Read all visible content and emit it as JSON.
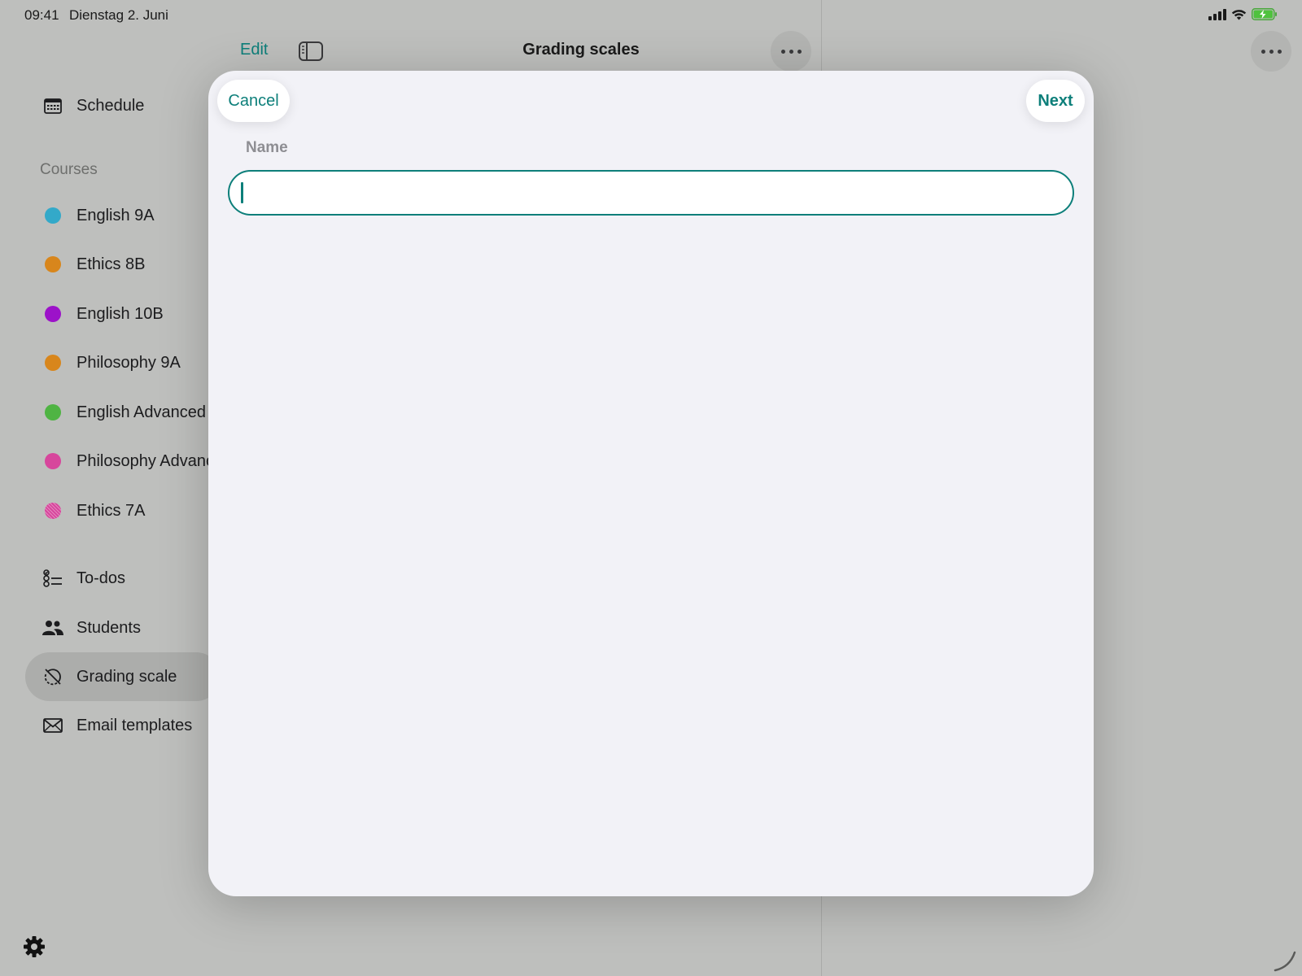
{
  "status_bar": {
    "time": "09:41",
    "date": "Dienstag 2. Juni",
    "icons": [
      "cellular-signal-icon",
      "wifi-icon",
      "battery-charging-icon"
    ]
  },
  "navigation": {
    "edit_label": "Edit",
    "title": "Grading scales"
  },
  "sidebar": {
    "schedule_label": "Schedule",
    "courses_header": "Courses",
    "courses": [
      {
        "label": "English 9A",
        "color": "#33a9c9"
      },
      {
        "label": "Ethics 8B",
        "color": "#d8861c"
      },
      {
        "label": "English 10B",
        "color": "#9c12c9"
      },
      {
        "label": "Philosophy 9A",
        "color": "#d8861c"
      },
      {
        "label": "English Advanced",
        "color": "#4fb443"
      },
      {
        "label": "Philosophy Advanced",
        "color": "#d7469c"
      },
      {
        "label": "Ethics 7A",
        "color": "#d7469c"
      }
    ],
    "items": [
      {
        "label": "To-dos",
        "icon": "todo-list-icon"
      },
      {
        "label": "Students",
        "icon": "people-icon"
      },
      {
        "label": "Grading scale",
        "icon": "grading-scale-icon",
        "selected": true
      },
      {
        "label": "Email templates",
        "icon": "envelope-icon"
      }
    ]
  },
  "sheet": {
    "cancel_label": "Cancel",
    "next_label": "Next",
    "name_label": "Name",
    "name_value": "",
    "name_placeholder": ""
  },
  "colors": {
    "accent": "#0d7f7a",
    "sheet_background": "#f2f2f7",
    "dimmed_background": "#bebfbd"
  }
}
